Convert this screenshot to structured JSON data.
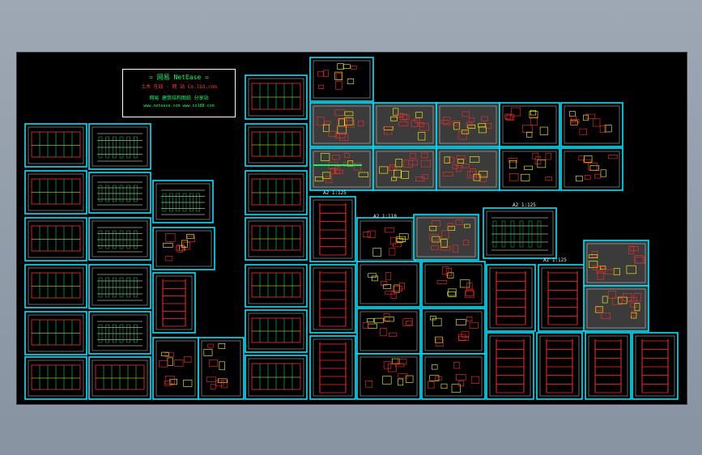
{
  "title_block": {
    "brand": "= 网易 NetEase =",
    "subtitle": "土木 在线 · 网 站   Co.lb3.com",
    "note": "网易 建筑结构图纸 分享站",
    "website": "www.netease.com   www.co188.com"
  },
  "sheet_labels": {
    "a": "A2 1:125",
    "b": "A2 1:110",
    "c": "A2 1:125",
    "d": "A2 1:125"
  },
  "colors": {
    "background": "#000000",
    "frame": "#00e5ff",
    "primary_line": "#ff2a2a",
    "secondary_line": "#00ff66",
    "highlight": "#ffff00",
    "text": "#ffffff"
  }
}
